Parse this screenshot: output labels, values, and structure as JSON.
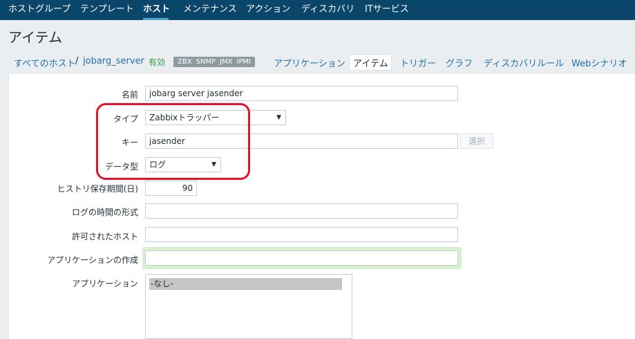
{
  "topnav": {
    "items": [
      "ホストグループ",
      "テンプレート",
      "ホスト",
      "メンテナンス",
      "アクション",
      "ディスカバリ",
      "ITサービス"
    ],
    "active_index": 2
  },
  "header": {
    "title": "アイテム"
  },
  "breadcrumb": {
    "all_hosts": "すべてのホスト",
    "separator": "/",
    "host": "jobarg_server",
    "status": "有効",
    "badges": [
      "ZBX",
      "SNMP",
      "JMX",
      "IPMI"
    ],
    "tabs": [
      "アプリケーション",
      "アイテム",
      "トリガー",
      "グラフ",
      "ディスカバリルール",
      "Webシナリオ"
    ],
    "active_tab": "アイテム"
  },
  "form": {
    "name_label": "名前",
    "name_value": "jobarg server jasender",
    "type_label": "タイプ",
    "type_value": "Zabbixトラッパー",
    "key_label": "キー",
    "key_value": "jasender",
    "select_button": "選択",
    "datatype_label": "データ型",
    "datatype_value": "ログ",
    "history_label": "ヒストリ保存期間(日)",
    "history_value": "90",
    "logtime_label": "ログの時間の形式",
    "logtime_value": "",
    "allowed_hosts_label": "許可されたホスト",
    "allowed_hosts_value": "",
    "new_app_label": "アプリケーションの作成",
    "new_app_value": "",
    "apps_label": "アプリケーション",
    "apps_options": [
      "-なし-"
    ]
  },
  "colors": {
    "nav_bg": "#0a466a",
    "link": "#1f6fa8",
    "status_ok": "#2e9e45",
    "annotation": "#e8112d"
  }
}
